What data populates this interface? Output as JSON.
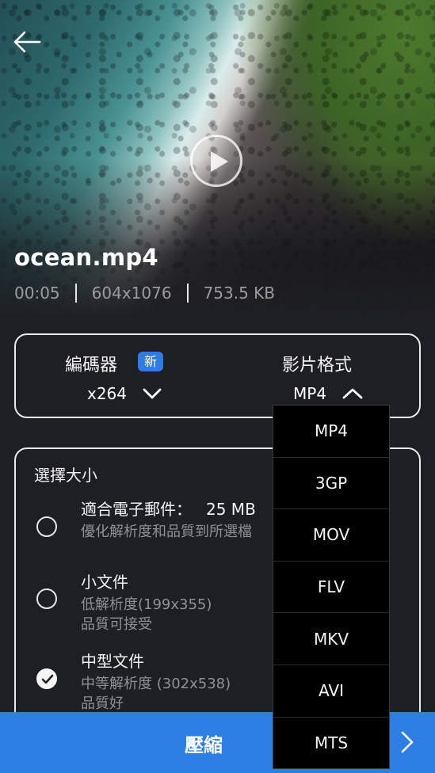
{
  "video": {
    "filename": "ocean.mp4",
    "duration": "00:05",
    "resolution": "604x1076",
    "filesize": "753.5 KB"
  },
  "settings": {
    "encoder_label": "編碼器",
    "new_badge": "新",
    "encoder_value": "x264",
    "format_label": "影片格式",
    "format_value": "MP4"
  },
  "size_section": {
    "title": "選擇大小",
    "options": [
      {
        "title": "適合電子郵件：",
        "size": "25 MB",
        "line1": "優化解析度和品質到所選檔",
        "line2": "",
        "selected": false
      },
      {
        "title": "小文件",
        "size": "",
        "line1": "低解析度(199x355)",
        "line2": "品質可接受",
        "selected": false
      },
      {
        "title": "中型文件",
        "size": "",
        "line1": "中等解析度 (302x538)",
        "line2": "品質好",
        "selected": true
      }
    ]
  },
  "compress_button": "壓縮",
  "format_dropdown": [
    "MP4",
    "3GP",
    "MOV",
    "FLV",
    "MKV",
    "AVI",
    "MTS"
  ],
  "icons": {
    "back": "back-arrow-icon",
    "play": "play-icon",
    "chevron_down": "chevron-down-icon",
    "chevron_up": "chevron-up-icon",
    "check": "check-icon",
    "next": "chevron-right-icon"
  },
  "colors": {
    "accent": "#2e7fe3",
    "badge": "#2f7de1",
    "background": "#1e1f24",
    "dropdown_bg": "#000000"
  }
}
